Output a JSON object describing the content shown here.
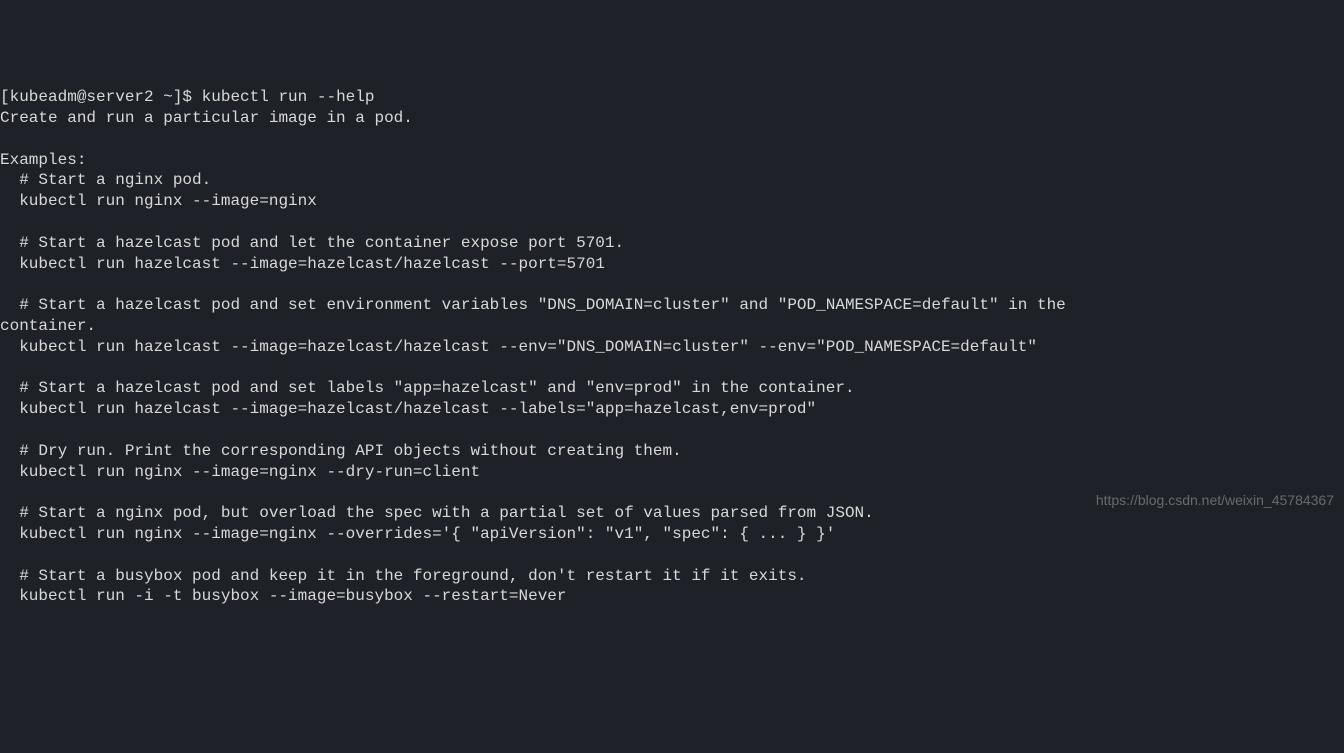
{
  "terminal": {
    "prompt": "[kubeadm@server2 ~]$ ",
    "command": "kubectl run --help",
    "output": "Create and run a particular image in a pod.\n\nExamples:\n  # Start a nginx pod.\n  kubectl run nginx --image=nginx\n\n  # Start a hazelcast pod and let the container expose port 5701.\n  kubectl run hazelcast --image=hazelcast/hazelcast --port=5701\n\n  # Start a hazelcast pod and set environment variables \"DNS_DOMAIN=cluster\" and \"POD_NAMESPACE=default\" in the\ncontainer.\n  kubectl run hazelcast --image=hazelcast/hazelcast --env=\"DNS_DOMAIN=cluster\" --env=\"POD_NAMESPACE=default\"\n\n  # Start a hazelcast pod and set labels \"app=hazelcast\" and \"env=prod\" in the container.\n  kubectl run hazelcast --image=hazelcast/hazelcast --labels=\"app=hazelcast,env=prod\"\n\n  # Dry run. Print the corresponding API objects without creating them.\n  kubectl run nginx --image=nginx --dry-run=client\n\n  # Start a nginx pod, but overload the spec with a partial set of values parsed from JSON.\n  kubectl run nginx --image=nginx --overrides='{ \"apiVersion\": \"v1\", \"spec\": { ... } }'\n\n  # Start a busybox pod and keep it in the foreground, don't restart it if it exits.\n  kubectl run -i -t busybox --image=busybox --restart=Never"
  },
  "watermark": "https://blog.csdn.net/weixin_45784367"
}
